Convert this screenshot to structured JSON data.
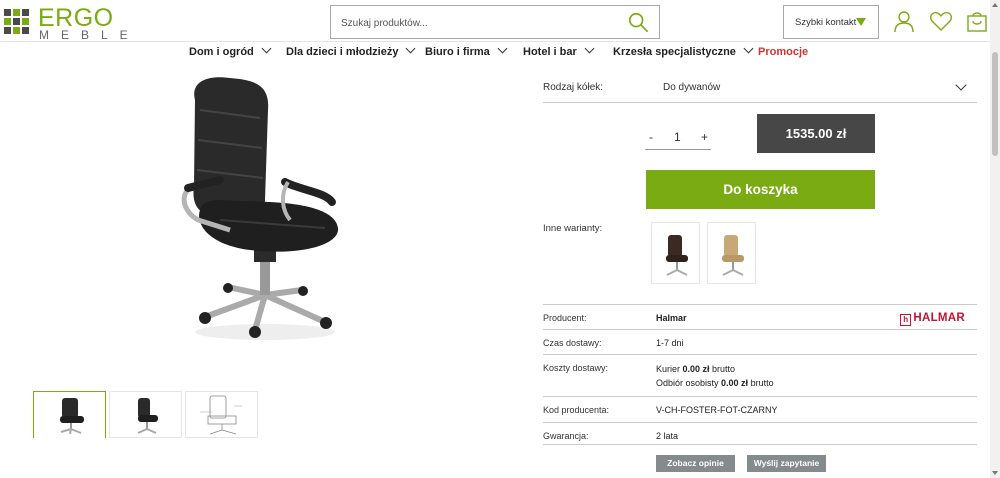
{
  "header": {
    "logo_top": "ERGO",
    "logo_bottom": "MEBLE",
    "search_placeholder": "Szukaj produktów...",
    "quick_contact": "Szybki kontakt"
  },
  "nav": {
    "items": [
      {
        "label": "Dom i ogród"
      },
      {
        "label": "Dla dzieci i młodzieży"
      },
      {
        "label": "Biuro i firma"
      },
      {
        "label": "Hotel i bar"
      },
      {
        "label": "Krzesła specjalistyczne"
      },
      {
        "label": "Promocje"
      }
    ]
  },
  "product": {
    "wheels_label": "Rodzaj kółek:",
    "wheels_value": "Do dywanów",
    "qty_minus": "-",
    "qty": "1",
    "qty_plus": "+",
    "price": "1535.00 zł",
    "add_to_cart": "Do koszyka",
    "variants_label": "Inne warianty:"
  },
  "details": {
    "producer_label": "Producent:",
    "producer_value": "Halmar",
    "brand_logo": "HALMAR",
    "brand_logo_mark": "h",
    "delivery_time_label": "Czas dostawy:",
    "delivery_time_value": "1-7 dni",
    "delivery_cost_label": "Koszty dostawy:",
    "courier_prefix": "Kurier ",
    "courier_price": "0.00 zł",
    "courier_suffix": " brutto",
    "pickup_prefix": "Odbiór osobisty ",
    "pickup_price": "0.00 zł",
    "pickup_suffix": " brutto",
    "code_label": "Kod producenta:",
    "code_value": "V-CH-FOSTER-FOT-CZARNY",
    "warranty_label": "Gwarancja:",
    "warranty_value": "2 lata"
  },
  "actions": {
    "reviews": "Zobacz opinie",
    "inquiry": "Wyślij zapytanie"
  },
  "colors": {
    "brand_green": "#7aab12",
    "promo_red": "#d23232",
    "price_bg": "#474747",
    "halmar_red": "#c8102e"
  },
  "icons": [
    "search-icon",
    "user-icon",
    "heart-icon",
    "cart-icon",
    "chevron-down-icon",
    "dropdown-triangle-icon"
  ]
}
